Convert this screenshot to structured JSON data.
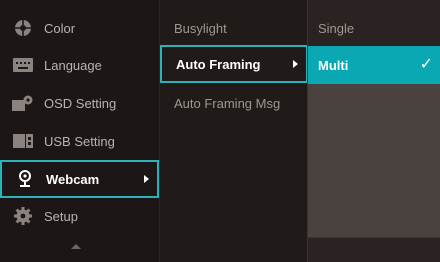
{
  "main_menu": {
    "items": [
      {
        "label": "Color",
        "icon": "color-wheel-icon"
      },
      {
        "label": "Language",
        "icon": "keyboard-icon"
      },
      {
        "label": "OSD Setting",
        "icon": "osd-gear-icon"
      },
      {
        "label": "USB Setting",
        "icon": "usb-device-icon"
      },
      {
        "label": "Webcam",
        "icon": "webcam-icon"
      },
      {
        "label": "Setup",
        "icon": "setup-gear-icon"
      }
    ],
    "selected": "Webcam"
  },
  "sub_menu": {
    "items": [
      {
        "label": "Busylight"
      },
      {
        "label": "Auto Framing"
      },
      {
        "label": "Auto Framing Msg"
      }
    ],
    "selected": "Auto Framing"
  },
  "options": {
    "items": [
      {
        "label": "Single"
      },
      {
        "label": "Multi"
      }
    ],
    "selected": "Multi",
    "check_glyph": "✓"
  },
  "colors": {
    "accent": "#0aa8b2",
    "selection_border": "#2ab3b8",
    "background": "#1c1716"
  }
}
